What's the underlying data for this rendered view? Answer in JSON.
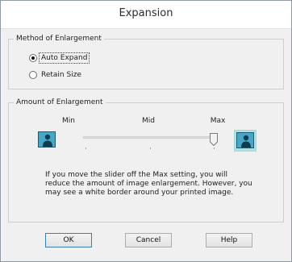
{
  "window": {
    "title": "Expansion"
  },
  "method_group": {
    "legend": "Method of Enlargement",
    "options": [
      {
        "label": "Auto Expand",
        "selected": true
      },
      {
        "label": "Retain Size",
        "selected": false
      }
    ]
  },
  "amount_group": {
    "legend": "Amount of Enlargement",
    "tick_labels": {
      "min": "Min",
      "mid": "Mid",
      "max": "Max"
    },
    "slider_value": "Max",
    "description": "If you move the slider off the Max setting, you will reduce the amount of image enlargement. However, you may see a white border around your printed image."
  },
  "buttons": {
    "ok": "OK",
    "cancel": "Cancel",
    "help": "Help"
  },
  "colors": {
    "image_fill": "#47a7c8",
    "image_highlight": "#aee3e5"
  }
}
